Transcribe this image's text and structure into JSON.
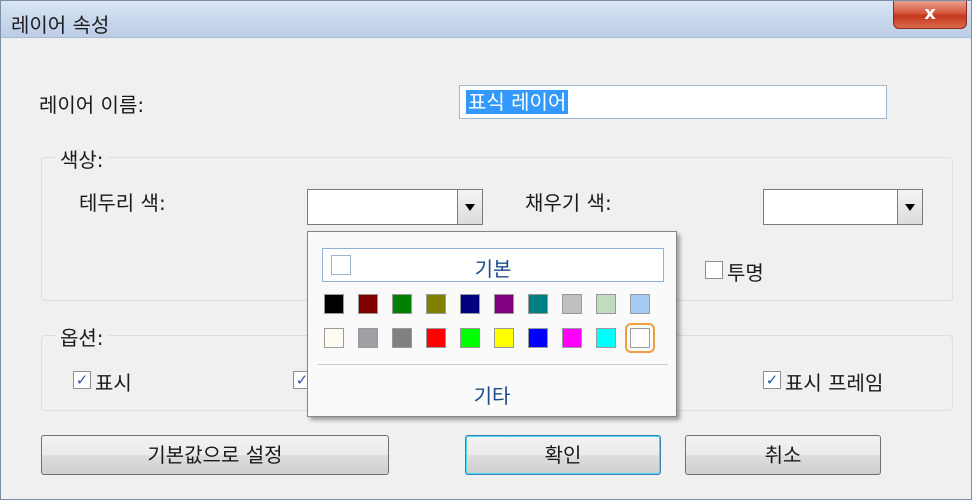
{
  "window": {
    "title": "레이어 속성",
    "close_glyph": "x"
  },
  "layer_name": {
    "label": "레이어 이름:",
    "value": "표식 레이어"
  },
  "color_group": {
    "legend": "색상:",
    "border_label": "테두리 색:",
    "fill_label": "채우기 색:",
    "transparent_label": "투명"
  },
  "options_group": {
    "legend": "옵션:",
    "show_label": "표시",
    "show_frame_label": "표시 프레임"
  },
  "buttons": {
    "defaults": "기본값으로 설정",
    "ok": "확인",
    "cancel": "취소"
  },
  "color_popup": {
    "default_label": "기본",
    "more_label": "기타",
    "row1": [
      "#000000",
      "#800000",
      "#008000",
      "#808000",
      "#000080",
      "#800080",
      "#008080",
      "#c0c0c0",
      "#c0dcc0",
      "#a6caf0"
    ],
    "row2": [
      "#fffbf0",
      "#a0a0a4",
      "#808080",
      "#ff0000",
      "#00ff00",
      "#ffff00",
      "#0000ff",
      "#ff00ff",
      "#00ffff",
      "#ffffff"
    ],
    "selected": "#ffffff"
  }
}
